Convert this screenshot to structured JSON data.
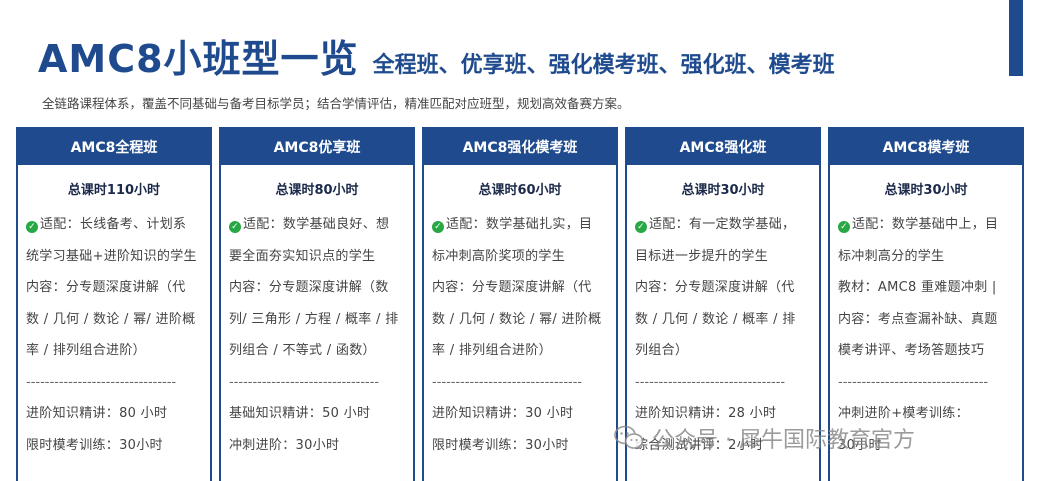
{
  "header": {
    "title": "AMC8小班型一览",
    "subtitle": "全程班、优享班、强化模考班、强化班、模考班",
    "description": "全链路课程体系，覆盖不同基础与备考目标学员；结合学情评估，精准匹配对应班型，规划高效备赛方案。"
  },
  "colors": {
    "accent": "#1f4b8e",
    "check": "#27a844"
  },
  "cards": [
    {
      "name": "AMC8全程班",
      "hours": "总课时110小时",
      "lines": [
        "适配：长线备考、计划系",
        "统学习基础+进阶知识的学生",
        "内容：分专题深度讲解（代",
        "数 / 几何 / 数论 / 幂/ 进阶概",
        "率 / 排列组合进阶）",
        "--------------------------------",
        "进阶知识精讲：80 小时",
        "限时模考训练：30小时"
      ]
    },
    {
      "name": "AMC8优享班",
      "hours": "总课时80小时",
      "lines": [
        "适配：数学基础良好、想",
        "要全面夯实知识点的学生",
        "内容：分专题深度讲解（数",
        "列/ 三角形 / 方程 / 概率 / 排",
        "列组合 / 不等式 / 函数）",
        "--------------------------------",
        "基础知识精讲：50 小时",
        "冲刺进阶：30小时"
      ]
    },
    {
      "name": "AMC8强化模考班",
      "hours": "总课时60小时",
      "lines": [
        "适配：数学基础扎实，目",
        "标冲刺高阶奖项的学生",
        "内容：分专题深度讲解（代",
        "数 / 几何 / 数论 / 幂/ 进阶概",
        "率 / 排列组合进阶）",
        "--------------------------------",
        "进阶知识精讲：30 小时",
        "限时模考训练：30小时"
      ]
    },
    {
      "name": "AMC8强化班",
      "hours": "总课时30小时",
      "lines": [
        "适配：有一定数学基础，",
        "目标进一步提升的学生",
        "内容：分专题深度讲解（代",
        "数 / 几何 / 数论 / 概率 / 排",
        "列组合）",
        "--------------------------------",
        "进阶知识精讲：28 小时",
        "综合测试讲评：2小时"
      ]
    },
    {
      "name": "AMC8模考班",
      "hours": "总课时30小时",
      "lines": [
        "适配：数学基础中上，目",
        "标冲刺高分的学生",
        "教材：AMC8  重难题冲刺  |",
        "内容：考点查漏补缺、真题",
        "模考讲评、考场答题技巧",
        "--------------------------------",
        "冲刺进阶+模考训练：",
        "30小时"
      ]
    }
  ],
  "watermark": {
    "icon": "wechat-icon",
    "text": "公众号 · 犀牛国际教育官方"
  }
}
